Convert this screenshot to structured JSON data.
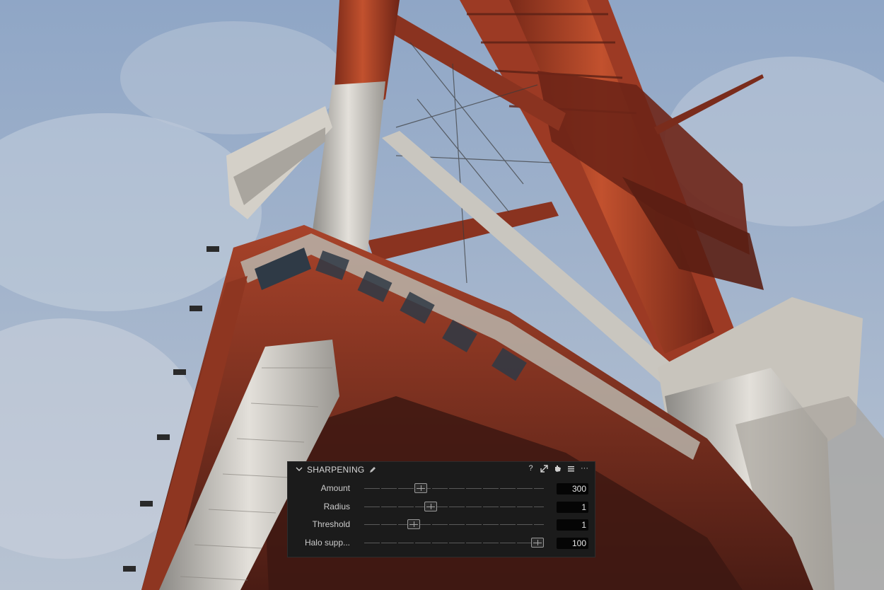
{
  "panel": {
    "title": "SHARPENING",
    "header_icons": [
      "help-icon",
      "expand-icon",
      "reset-icon",
      "menu-icon",
      "more-icon"
    ],
    "help_glyph": "?",
    "more_glyph": "···",
    "rows": [
      {
        "label": "Amount",
        "value": "300",
        "level": 0.3
      },
      {
        "label": "Radius",
        "value": "1",
        "level": 0.36
      },
      {
        "label": "Threshold",
        "value": "1",
        "level": 0.26
      },
      {
        "label": "Halo supp...",
        "value": "100",
        "level": 1.0
      }
    ]
  },
  "colors": {
    "panel_bg": "#1b1b1b",
    "value_bg": "#050505",
    "sky": "#a9bbd2",
    "tower_red": "#b5462a",
    "tower_white": "#d9d6cf"
  }
}
